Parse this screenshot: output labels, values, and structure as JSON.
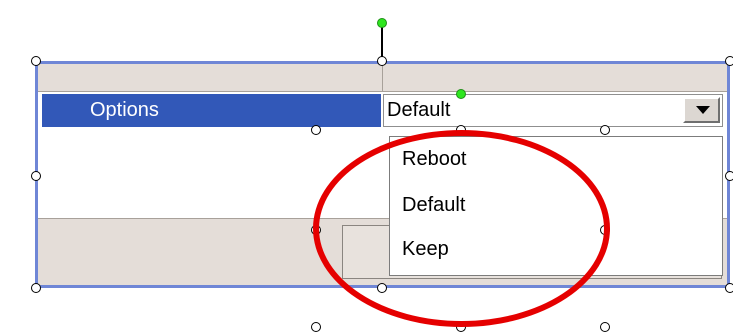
{
  "grid": {
    "options_label": "Options",
    "selected_value": "Default"
  },
  "dropdown": {
    "options": [
      "Reboot",
      "Default",
      "Keep"
    ]
  },
  "colors": {
    "selection_blue": "#3258b8",
    "frame_blue": "#6f86d6",
    "highlight_red": "#e50000",
    "handle_green": "#2ee61f",
    "panel_gray": "#e4ddd8"
  },
  "icons": {
    "dropdown": "chevron-down-icon"
  }
}
